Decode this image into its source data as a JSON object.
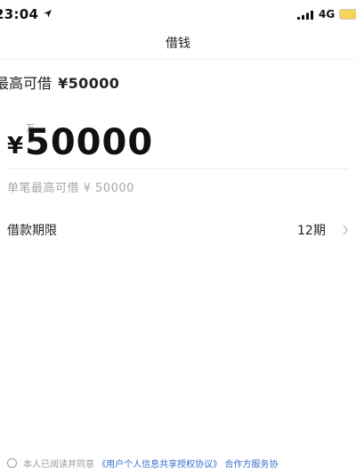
{
  "status_bar": {
    "time": "23:04",
    "network": "4G"
  },
  "nav": {
    "title": "借钱"
  },
  "limit": {
    "label": "最高可借",
    "amount": "¥50000"
  },
  "amount_input": {
    "unit_hint": "万",
    "currency_symbol": "¥",
    "value": "50000",
    "hint": "单笔最高可借 ¥ 50000"
  },
  "term": {
    "label": "借款期限",
    "value": "12期"
  },
  "agreement": {
    "prefix": "本人已阅读并同意",
    "link1": "《用户个人信息共享授权协议》",
    "link2": "合作方服务协"
  },
  "colors": {
    "link": "#3b6fd1",
    "hint": "#a7a7a7",
    "battery": "#f6d35a"
  }
}
